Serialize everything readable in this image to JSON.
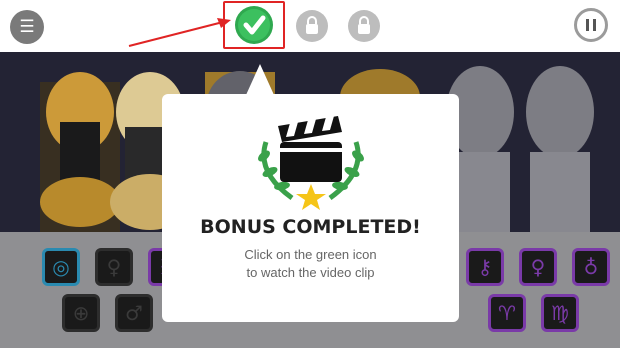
{
  "menu": {
    "icon": "hamburger-menu-icon"
  },
  "bonus": {
    "icon": "green-checkmark-icon",
    "highlight_color": "#e02424",
    "accent": "#2fa84f"
  },
  "locks": [
    {
      "icon": "lock-icon"
    },
    {
      "icon": "lock-icon"
    }
  ],
  "pause": {
    "icon": "pause-icon"
  },
  "dialog": {
    "illustration": "clapperboard-laurel-star-icon",
    "title": "BONUS COMPLETED!",
    "message_line1": "Click on the green icon",
    "message_line2": "to watch the video clip"
  },
  "shelf_icons": [
    {
      "row": 1,
      "glyph": "◎",
      "name": "circle-target-icon",
      "state": "blue"
    },
    {
      "row": 1,
      "glyph": "♀",
      "name": "female-sign-icon",
      "state": "plain"
    },
    {
      "row": 1,
      "glyph": "♓",
      "name": "pisces-icon",
      "state": "purple"
    },
    {
      "row": 1,
      "glyph": "♀",
      "name": "venus-sign-icon",
      "state": "purple"
    },
    {
      "row": 1,
      "glyph": "♃",
      "name": "jupiter-icon",
      "state": "purple"
    },
    {
      "row": 1,
      "glyph": "♇",
      "name": "pluto-icon",
      "state": "purple"
    },
    {
      "row": 1,
      "glyph": "♄",
      "name": "saturn-icon",
      "state": "purple"
    },
    {
      "row": 1,
      "glyph": "⚳",
      "name": "ceres-icon",
      "state": "purple"
    },
    {
      "row": 1,
      "glyph": "⚷",
      "name": "chiron-icon",
      "state": "purple"
    },
    {
      "row": 1,
      "glyph": "♀",
      "name": "venus-icon",
      "state": "purple"
    },
    {
      "row": 1,
      "glyph": "♁",
      "name": "earth-icon",
      "state": "purple"
    },
    {
      "row": 1,
      "glyph": "♅",
      "name": "uranus-icon",
      "state": "purple"
    },
    {
      "row": 1,
      "glyph": "♆",
      "name": "neptune-icon",
      "state": "purple"
    },
    {
      "row": 2,
      "glyph": "⊕",
      "name": "circle-cross-icon",
      "state": "plain"
    },
    {
      "row": 2,
      "glyph": "♂",
      "name": "male-sign-icon",
      "state": "plain"
    },
    {
      "row": 2,
      "glyph": "♈",
      "name": "aries-icon",
      "state": "purple"
    },
    {
      "row": 2,
      "glyph": "♍",
      "name": "virgo-icon",
      "state": "purple"
    }
  ]
}
